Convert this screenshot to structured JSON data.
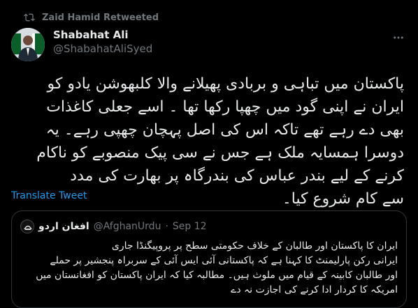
{
  "retweet": {
    "label": "Zaid Hamid Retweeted"
  },
  "author": {
    "name": "Shabahat Ali",
    "handle": "@ShabahatAliSyed"
  },
  "tweet": {
    "text": "پاکستان میں تباہی و بربادی پھیلانے والا کلبھوشن یادو کو\nایران نے اپنی گود میں چھپا رکھا تھا ۔ اسے جعلی کاغذات\nبھی دے رہے تھے تاکہ اس کی اصل پہچان چھپی رہے۔ یہ\nدوسرا ہمسایہ ملک ہے جس نے سی پیک منصوبے کو ناکام\nکرنے کے لیے بندر عباس کی بندرگاہ پر بھارت کی مدد\nسے کام شروع کیا۔",
    "translate_label": "Translate Tweet"
  },
  "quote": {
    "name": "افغان اردو",
    "handle": "@AfghanUrdu",
    "separator": "·",
    "date": "Sep 12",
    "text": "ایران کا پاکستان اور طالبان کے خلاف حکومتی سطح پر پروپیگنڈا جاری\nایرانی رکن پارلیمنٹ کا کہنا ہے کہ پاکستانی آئی ایس آئی کے سربراہ پنجشیر پر حملے\nاور طالبان کابینہ کے قیام میں ملوث ہیں۔ مطالبہ کیا کہ ایران پاکستان کو افغانستان میں\nامریکہ کا کردار ادا کرنے کی اجازت نہ دے"
  },
  "colors": {
    "background": "#000000",
    "text": "#e7e9ea",
    "secondary": "#71767b",
    "link": "#1d9bf0",
    "border": "#2f3336"
  },
  "icons": {
    "retweet": "retweet-icon",
    "more": "more-icon"
  }
}
